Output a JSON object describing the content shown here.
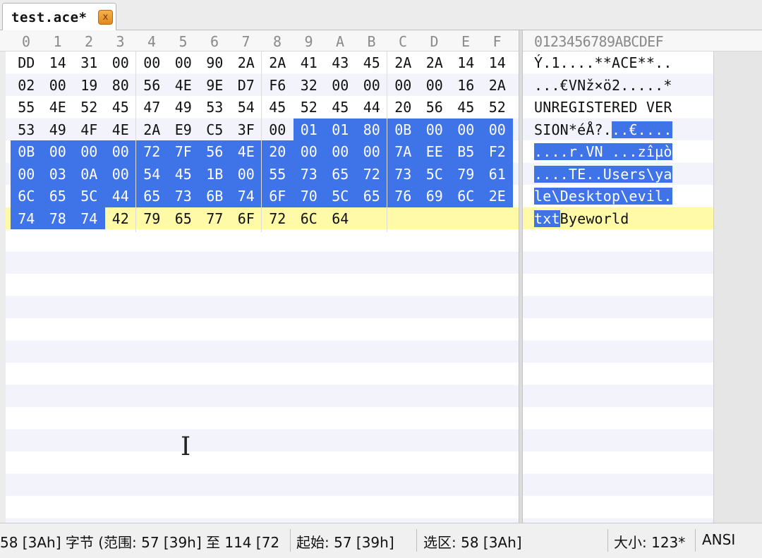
{
  "tab": {
    "title": "test.ace*",
    "close_label": "x"
  },
  "header": {
    "hex_columns": [
      "0",
      "1",
      "2",
      "3",
      "4",
      "5",
      "6",
      "7",
      "8",
      "9",
      "A",
      "B",
      "C",
      "D",
      "E",
      "F"
    ],
    "ascii_header": "0123456789ABCDEF"
  },
  "hex_rows": [
    [
      "DD",
      "14",
      "31",
      "00",
      "00",
      "00",
      "90",
      "2A",
      "2A",
      "41",
      "43",
      "45",
      "2A",
      "2A",
      "14",
      "14"
    ],
    [
      "02",
      "00",
      "19",
      "80",
      "56",
      "4E",
      "9E",
      "D7",
      "F6",
      "32",
      "00",
      "00",
      "00",
      "00",
      "16",
      "2A"
    ],
    [
      "55",
      "4E",
      "52",
      "45",
      "47",
      "49",
      "53",
      "54",
      "45",
      "52",
      "45",
      "44",
      "20",
      "56",
      "45",
      "52"
    ],
    [
      "53",
      "49",
      "4F",
      "4E",
      "2A",
      "E9",
      "C5",
      "3F",
      "00",
      "01",
      "01",
      "80",
      "0B",
      "00",
      "00",
      "00"
    ],
    [
      "0B",
      "00",
      "00",
      "00",
      "72",
      "7F",
      "56",
      "4E",
      "20",
      "00",
      "00",
      "00",
      "7A",
      "EE",
      "B5",
      "F2"
    ],
    [
      "00",
      "03",
      "0A",
      "00",
      "54",
      "45",
      "1B",
      "00",
      "55",
      "73",
      "65",
      "72",
      "73",
      "5C",
      "79",
      "61"
    ],
    [
      "6C",
      "65",
      "5C",
      "44",
      "65",
      "73",
      "6B",
      "74",
      "6F",
      "70",
      "5C",
      "65",
      "76",
      "69",
      "6C",
      "2E"
    ],
    [
      "74",
      "78",
      "74",
      "42",
      "79",
      "65",
      "77",
      "6F",
      "72",
      "6C",
      "64"
    ]
  ],
  "ascii_rows": [
    "Ý.1....**ACE**..",
    "...€VNž×ö2.....*",
    "UNREGISTERED VER",
    "SION*éÅ?...€....",
    "....r.VN ...zîµò",
    "....TE..Users\\ya",
    "le\\Desktop\\evil.",
    "txtByeworld"
  ],
  "selection": {
    "start": 57,
    "end": 114
  },
  "highlight_changed": [
    59,
    60,
    61
  ],
  "status": {
    "range": "58 [3Ah] 字节 (范围: 57 [39h] 至 114 [72",
    "start": "起始: 57 [39h]",
    "selection": "选区: 58 [3Ah]",
    "size": "大小: 123*",
    "encoding": "ANSI"
  },
  "colors": {
    "selection": "#3f73e8",
    "changed_text": "#ef6c1a",
    "current_row": "#fffaa8",
    "tab_close": "#f0a030"
  }
}
